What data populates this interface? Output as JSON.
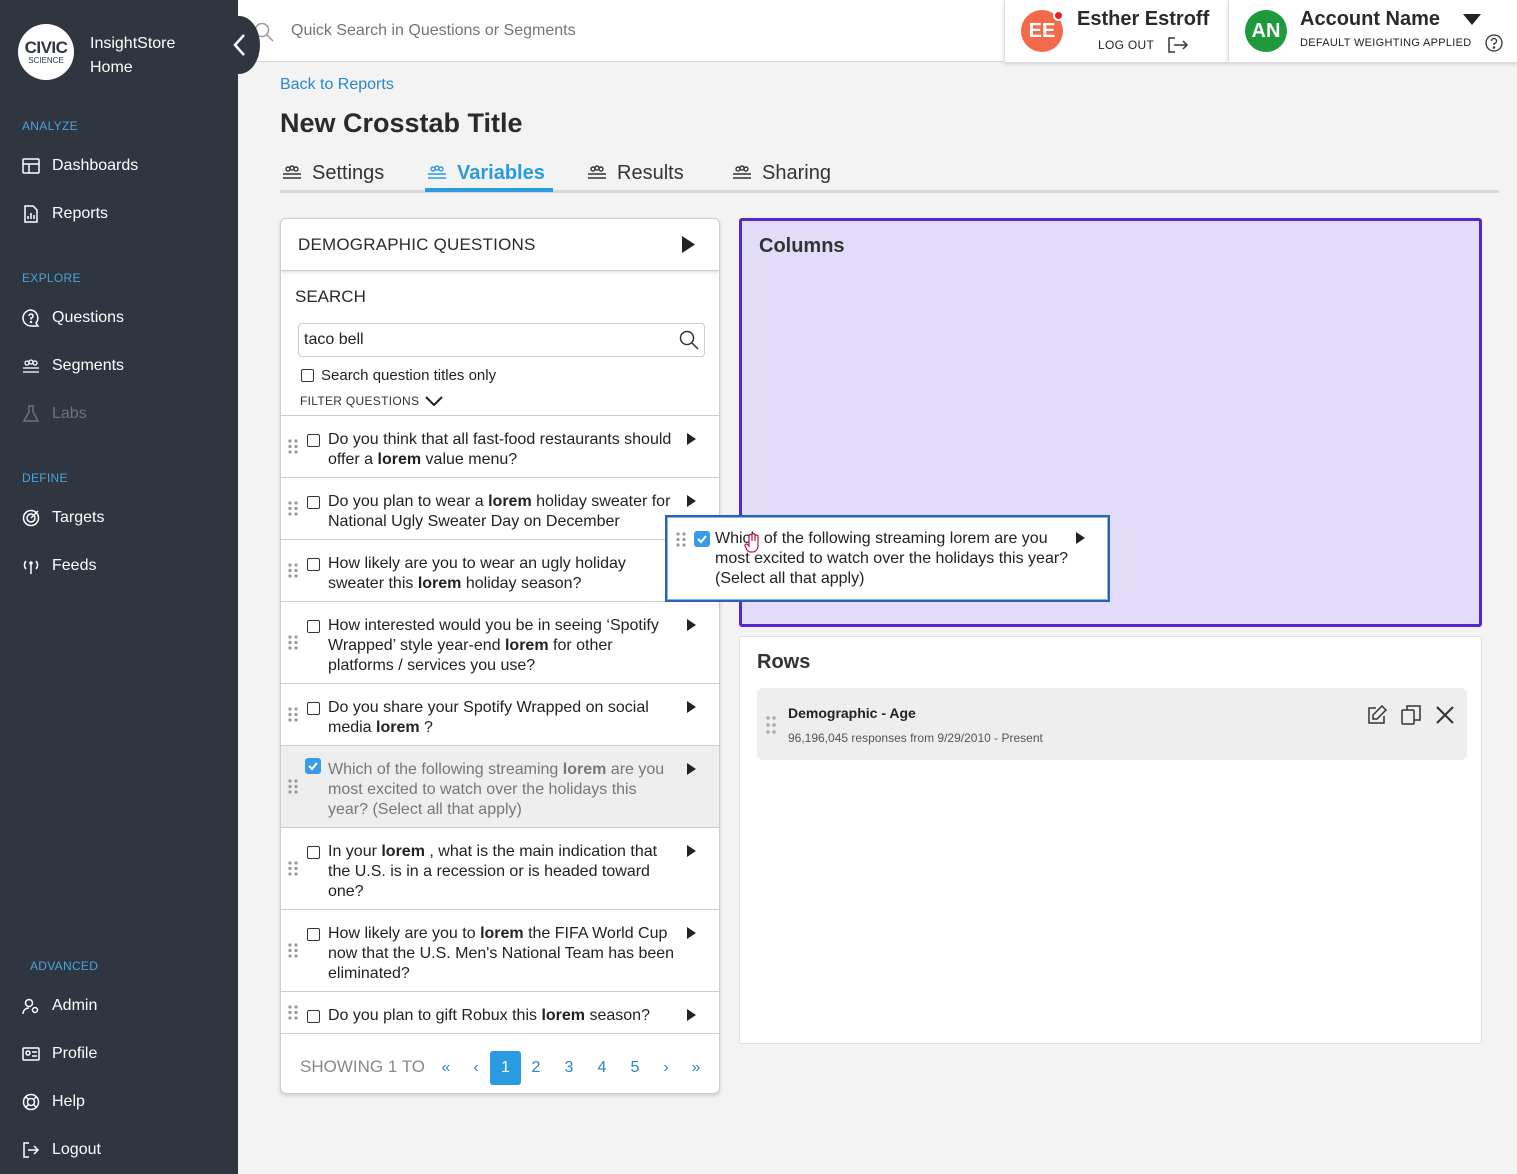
{
  "brand": {
    "logo_line1": "CIVIC",
    "logo_line2": "SCIENCE",
    "app_name": "InsightStore",
    "app_home": "Home"
  },
  "sidebar": {
    "sections": {
      "analyze": "ANALYZE",
      "explore": "EXPLORE",
      "define": "DEFINE",
      "advanced": "ADVANCED"
    },
    "items": {
      "dashboards": "Dashboards",
      "reports": "Reports",
      "questions": "Questions",
      "segments": "Segments",
      "labs": "Labs",
      "targets": "Targets",
      "feeds": "Feeds",
      "admin": "Admin",
      "profile": "Profile",
      "help": "Help",
      "logout": "Logout"
    }
  },
  "topbar": {
    "search_placeholder": "Quick Search in Questions or Segments",
    "user": {
      "initials": "EE",
      "name": "Esther Estroff",
      "logout_label": "LOG OUT",
      "avatar_color": "#f26a4b"
    },
    "account": {
      "initials": "AN",
      "name": "Account Name",
      "weighting": "DEFAULT WEIGHTING APPLIED",
      "avatar_color": "#1e9a3c"
    }
  },
  "page": {
    "back_link": "Back to Reports",
    "title": "New Crosstab Title",
    "tabs": [
      "Settings",
      "Variables",
      "Results",
      "Sharing"
    ],
    "active_tab": "Variables"
  },
  "left_panel": {
    "header": "DEMOGRAPHIC QUESTIONS",
    "search_label": "SEARCH",
    "search_value": "taco bell",
    "titles_only_label": "Search question titles only",
    "titles_only_checked": false,
    "filter_label": "FILTER QUESTIONS",
    "questions": [
      {
        "pre": "Do you think that all fast-food restaurants should offer a ",
        "bold": "lorem",
        "post": " value menu?",
        "checked": false
      },
      {
        "pre": "Do you plan to wear a ",
        "bold": "lorem",
        "post": " holiday sweater for National Ugly Sweater Day on December",
        "checked": false
      },
      {
        "pre": "How likely are you to wear an ugly holiday sweater this ",
        "bold": "lorem",
        "post": " holiday season?",
        "checked": false
      },
      {
        "pre": "How interested would you be in seeing ‘Spotify Wrapped’ style year-end ",
        "bold": "lorem",
        "post": " for other platforms / services you use?",
        "checked": false
      },
      {
        "pre": "Do you share your Spotify Wrapped on social media ",
        "bold": "lorem",
        "post": " ?",
        "checked": false
      },
      {
        "pre": "Which of the following streaming ",
        "bold": "lorem",
        "post": " are you most excited to watch over the holidays this year? (Select all that apply)",
        "checked": true
      },
      {
        "pre": "In your ",
        "bold": "lorem",
        "post": " , what is the main indication that the U.S. is in a recession or is headed toward one?",
        "checked": false
      },
      {
        "pre": "How likely are you to ",
        "bold": "lorem",
        "post": " the FIFA World Cup now that the U.S. Men's National Team has been eliminated?",
        "checked": false
      },
      {
        "pre": "Do you plan to gift Robux this ",
        "bold": "lorem",
        "post": " season?",
        "checked": false
      }
    ],
    "pager": {
      "showing": "SHOWING 1 TO",
      "first": "«",
      "prev": "‹",
      "pages": [
        "1",
        "2",
        "3",
        "4",
        "5"
      ],
      "current": "1",
      "next": "›",
      "last": "»"
    }
  },
  "columns": {
    "title": "Columns"
  },
  "dragging": {
    "text": "Which of the following streaming lorem are you most excited to watch over the holidays this year? (Select all that apply)",
    "checked": true
  },
  "rows": {
    "title": "Rows",
    "items": [
      {
        "title": "Demographic - Age",
        "subtitle": "96,196,045 responses from 9/29/2010 - Present"
      }
    ]
  },
  "colors": {
    "sidebar": "#2f3640",
    "accent": "#2a9be0",
    "columns_bg": "#e3dbfa",
    "columns_border": "#5528cf"
  }
}
